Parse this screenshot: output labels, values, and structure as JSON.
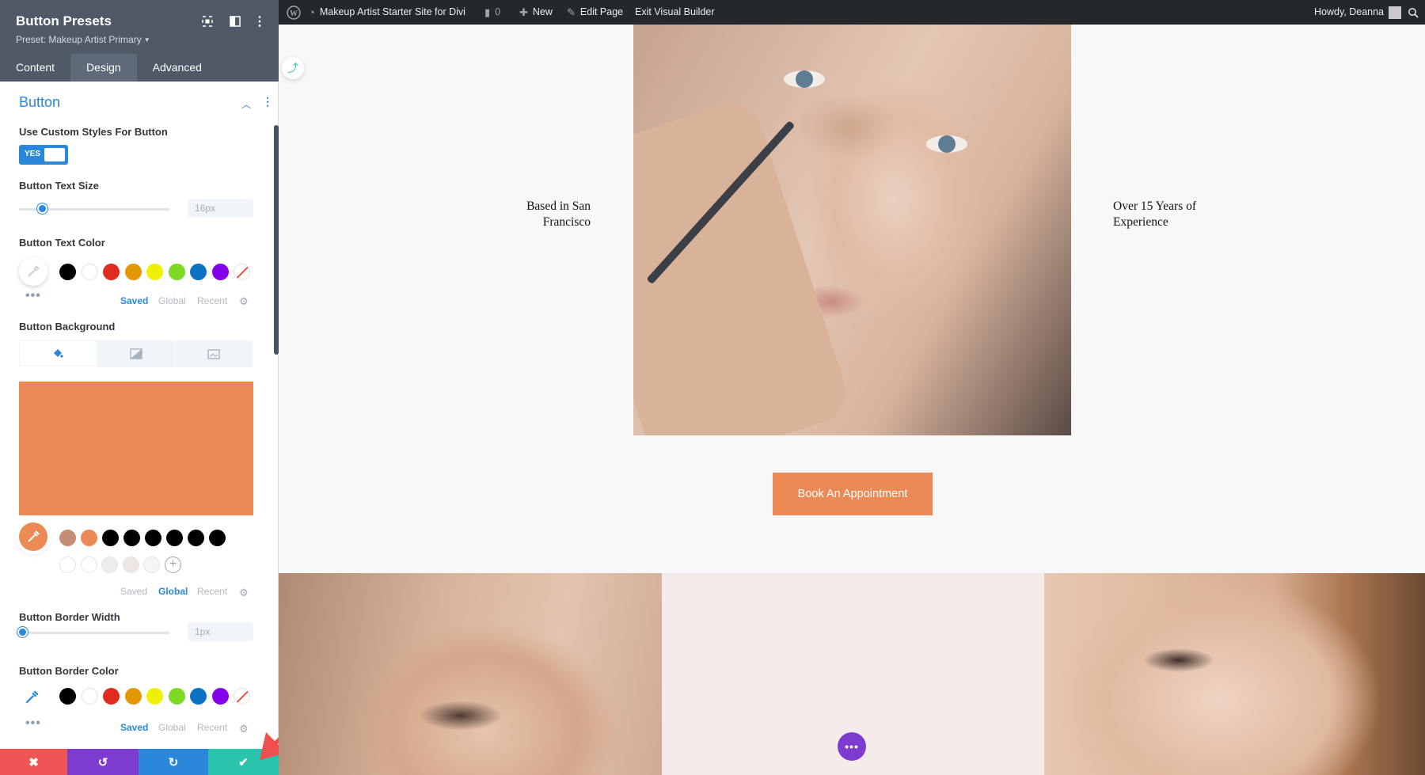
{
  "sidebar": {
    "title": "Button Presets",
    "preset_label": "Preset: Makeup Artist Primary",
    "tabs": [
      {
        "label": "Content"
      },
      {
        "label": "Design"
      },
      {
        "label": "Advanced"
      }
    ],
    "active_tab": "Design",
    "section_title": "Button",
    "fields": {
      "custom_styles": {
        "label": "Use Custom Styles For Button",
        "toggle_text": "YES"
      },
      "text_size": {
        "label": "Button Text Size",
        "value": "16px",
        "level": 0.15
      },
      "text_color": {
        "label": "Button Text Color"
      },
      "background": {
        "label": "Button Background",
        "color": "#ec8a55"
      },
      "border_width": {
        "label": "Button Border Width",
        "value": "1px",
        "level": 0.02
      },
      "border_color": {
        "label": "Button Border Color"
      }
    },
    "palette_tabs": {
      "text_color": [
        {
          "label": "Saved",
          "active": true
        },
        {
          "label": "Global",
          "active": false
        },
        {
          "label": "Recent",
          "active": false
        }
      ],
      "background": [
        {
          "label": "Saved",
          "active": false
        },
        {
          "label": "Global",
          "active": true
        },
        {
          "label": "Recent",
          "active": false
        }
      ],
      "border_color": [
        {
          "label": "Saved",
          "active": true
        },
        {
          "label": "Global",
          "active": false
        },
        {
          "label": "Recent",
          "active": false
        }
      ]
    },
    "swatches": [
      "#000000",
      "#ffffff",
      "#e02b20",
      "#e09900",
      "#edf000",
      "#7cda24",
      "#0c71c3",
      "#8300e9"
    ],
    "global_swatches": [
      "#c58d74",
      "#ec8a55",
      "#000000",
      "#000000",
      "#000000",
      "#000000",
      "#000000",
      "#000000"
    ],
    "action_bar": [
      {
        "name": "discard-button",
        "color": "#ef5555",
        "glyph": "✖"
      },
      {
        "name": "undo-button",
        "color": "#7e3bd0",
        "glyph": "↺"
      },
      {
        "name": "redo-button",
        "color": "#2b87da",
        "glyph": "↻"
      },
      {
        "name": "save-button",
        "color": "#29c4a9",
        "glyph": "✔"
      }
    ]
  },
  "adminbar": {
    "site_name": "Makeup Artist Starter Site for Divi",
    "comments_count": "0",
    "new_label": "New",
    "edit_label": "Edit Page",
    "exit_label": "Exit Visual Builder",
    "greeting": "Howdy, Deanna"
  },
  "page": {
    "left_text": "Based in San Francisco",
    "right_text": "Over 15 Years of Experience",
    "cta_label": "Book An Appointment",
    "accent_color": "#ec8a55"
  }
}
